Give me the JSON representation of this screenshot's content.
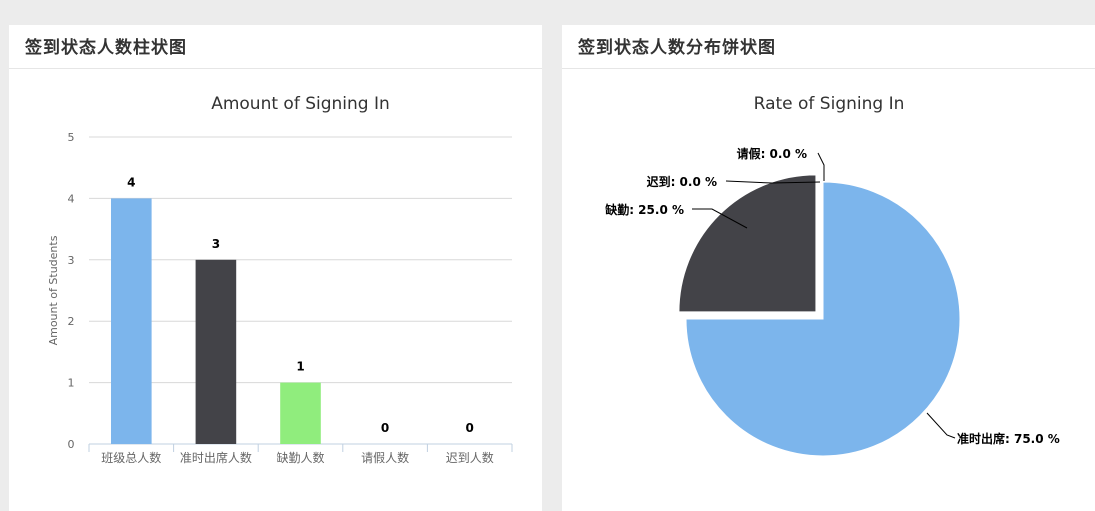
{
  "left_panel": {
    "header": "签到状态人数柱状图"
  },
  "right_panel": {
    "header": "签到状态人数分布饼状图"
  },
  "chart_data": [
    {
      "type": "bar",
      "title": "Amount of Signing In",
      "ylabel": "Amount of Students",
      "xlabel": "",
      "ylim": [
        0,
        5
      ],
      "yticks": [
        "0",
        "1",
        "2",
        "3",
        "4",
        "5"
      ],
      "categories": [
        "班级总人数",
        "准时出席人数",
        "缺勤人数",
        "请假人数",
        "迟到人数"
      ],
      "values": [
        4,
        3,
        1,
        0,
        0
      ],
      "value_labels": [
        "4",
        "3",
        "1",
        "0",
        "0"
      ],
      "colors": [
        "#7cb5ec",
        "#434348",
        "#90ed7d",
        "#f7a35c",
        "#8085e9"
      ],
      "grid": true,
      "legend": "none"
    },
    {
      "type": "pie",
      "title": "Rate of Signing In",
      "slices": [
        {
          "label": "准时出席",
          "value": 75.0,
          "display": "准时出席: 75.0 %",
          "color": "#7cb5ec"
        },
        {
          "label": "缺勤",
          "value": 25.0,
          "display": "缺勤: 25.0 %",
          "color": "#434348",
          "sliced": true
        },
        {
          "label": "迟到",
          "value": 0.0,
          "display": "迟到: 0.0 %",
          "color": "#90ed7d"
        },
        {
          "label": "请假",
          "value": 0.0,
          "display": "请假: 0.0 %",
          "color": "#f7a35c"
        }
      ],
      "legend": "none"
    }
  ]
}
